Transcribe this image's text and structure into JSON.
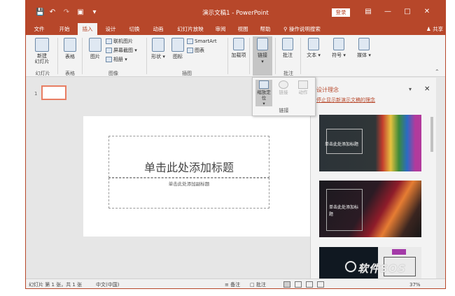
{
  "app": {
    "title": "演示文稿1 - PowerPoint",
    "login_label": "登录",
    "tell_me": "操作说明搜索",
    "share_label": "共享"
  },
  "tabs": [
    {
      "label": "文件"
    },
    {
      "label": "开始"
    },
    {
      "label": "插入",
      "active": true
    },
    {
      "label": "设计"
    },
    {
      "label": "切换"
    },
    {
      "label": "动画"
    },
    {
      "label": "幻灯片放映"
    },
    {
      "label": "审阅"
    },
    {
      "label": "视图"
    },
    {
      "label": "帮助"
    }
  ],
  "ribbon": {
    "new_slide": "新建\n幻灯片",
    "table": "表格",
    "picture": "图片",
    "online_picture": "联机图片",
    "screenshot": "屏幕截图",
    "album": "相册",
    "shapes": "形状",
    "icons": "图标",
    "smartart": "SmartArt",
    "chart": "图表",
    "addins": "加载项",
    "link": "链接",
    "comment": "批注",
    "text": "文本",
    "symbol": "符号",
    "media": "媒体",
    "groups": {
      "slides": "幻灯片",
      "tables": "表格",
      "images": "图像",
      "illustrations": "插图",
      "comments": "批注"
    }
  },
  "link_menu": {
    "zoom": "缩放定位",
    "link": "链接",
    "action": "动作",
    "group": "链接"
  },
  "thumbs": {
    "number": "1"
  },
  "slide": {
    "title_placeholder": "单击此处添加标题",
    "subtitle_placeholder": "单击此处添加副标题"
  },
  "design_ideas": {
    "title": "设计理念",
    "stop_link": "停止显示新演示文稿的理念",
    "d1_text": "单击此处添加标题",
    "d2_text": "单击此处添加标\n题"
  },
  "status": {
    "slide_count": "幻灯片 第 1 张，共 1 张",
    "language": "中文(中国)",
    "notes": "备注",
    "comments": "批注",
    "zoom": "37%"
  },
  "watermark": "软件SOS",
  "colors": {
    "accent": "#b7472a",
    "ribbon": "#f3f3f3",
    "workspace": "#e6e6e6"
  }
}
